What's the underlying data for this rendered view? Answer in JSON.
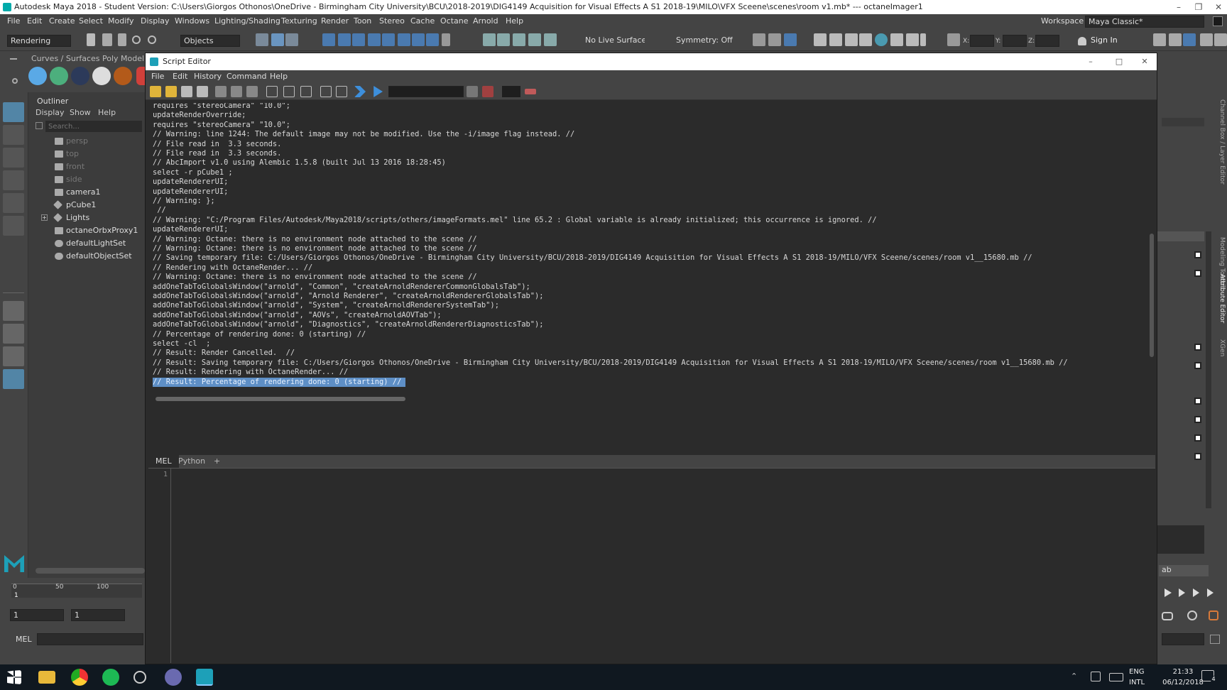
{
  "app": {
    "window_title": "Autodesk Maya 2018 - Student Version: C:\\Users\\Giorgos Othonos\\OneDrive - Birmingham City University\\BCU\\2018-2019\\DIG4149 Acquisition for Visual Effects A S1 2018-19\\MILO\\VFX Sceene\\scenes\\room v1.mb*   ---   octaneImager1",
    "menu": [
      "File",
      "Edit",
      "Create",
      "Select",
      "Modify",
      "Display",
      "Windows",
      "Lighting/Shading",
      "Texturing",
      "Render",
      "Toon",
      "Stereo",
      "Cache",
      "Octane",
      "Arnold",
      "Help"
    ],
    "workspace_label": "Workspace :",
    "workspace_value": "Maya Classic*",
    "menu_set": "Rendering",
    "selection_mode": "Objects",
    "live_surface": "No Live Surface",
    "symmetry": "Symmetry: Off",
    "sign_in": "Sign In",
    "xyz": [
      "X:",
      "Y:",
      "Z:"
    ]
  },
  "shelf": {
    "tabs": [
      "Curves / Surfaces",
      "Poly Modeling"
    ]
  },
  "outliner": {
    "title": "Outliner",
    "menu": [
      "Display",
      "Show",
      "Help"
    ],
    "search_placeholder": "Search...",
    "items": [
      {
        "label": "persp",
        "dim": true
      },
      {
        "label": "top",
        "dim": true
      },
      {
        "label": "front",
        "dim": true
      },
      {
        "label": "side",
        "dim": true
      },
      {
        "label": "camera1",
        "dim": false
      },
      {
        "label": "pCube1",
        "dim": false
      },
      {
        "label": "Lights",
        "dim": false,
        "expander": true
      },
      {
        "label": "octaneOrbxProxy1",
        "dim": false
      },
      {
        "label": "defaultLightSet",
        "dim": false
      },
      {
        "label": "defaultObjectSet",
        "dim": false
      }
    ]
  },
  "timeline": {
    "ticks": [
      "0",
      "50",
      "100"
    ],
    "current": "1",
    "start": "1",
    "end": "1"
  },
  "cmdline": {
    "label": "MEL"
  },
  "right_panel": {
    "side_tabs": [
      "Channel Box / Layer Editor",
      "Modeling Toolkit",
      "Attribute Editor",
      "XGen"
    ],
    "tab_partial": "ab"
  },
  "script_editor": {
    "title": "Script Editor",
    "menu": [
      "File",
      "Edit",
      "History",
      "Command",
      "Help"
    ],
    "history": [
      "requires \"stereoCamera\" \"10.0\";",
      "updateRenderOverride;",
      "requires \"stereoCamera\" \"10.0\";",
      "// Warning: line 1244: The default image may not be modified. Use the -i/image flag instead. //",
      "// File read in  3.3 seconds.",
      "// File read in  3.3 seconds.",
      "// AbcImport v1.0 using Alembic 1.5.8 (built Jul 13 2016 18:28:45)",
      "select -r pCube1 ;",
      "updateRendererUI;",
      "updateRendererUI;",
      "// Warning: };",
      " //",
      "// Warning: \"C:/Program Files/Autodesk/Maya2018/scripts/others/imageFormats.mel\" line 65.2 : Global variable is already initialized; this occurrence is ignored. //",
      "updateRendererUI;",
      "// Warning: Octane: there is no environment node attached to the scene //",
      "// Warning: Octane: there is no environment node attached to the scene //",
      "// Saving temporary file: C:/Users/Giorgos Othonos/OneDrive - Birmingham City University/BCU/2018-2019/DIG4149 Acquisition for Visual Effects A S1 2018-19/MILO/VFX Sceene/scenes/room v1__15680.mb //",
      "// Rendering with OctaneRender... //",
      "// Warning: Octane: there is no environment node attached to the scene //",
      "addOneTabToGlobalsWindow(\"arnold\", \"Common\", \"createArnoldRendererCommonGlobalsTab\");",
      "addOneTabToGlobalsWindow(\"arnold\", \"Arnold Renderer\", \"createArnoldRendererGlobalsTab\");",
      "addOneTabToGlobalsWindow(\"arnold\", \"System\", \"createArnoldRendererSystemTab\");",
      "addOneTabToGlobalsWindow(\"arnold\", \"AOVs\", \"createArnoldAOVTab\");",
      "addOneTabToGlobalsWindow(\"arnold\", \"Diagnostics\", \"createArnoldRendererDiagnosticsTab\");",
      "// Percentage of rendering done: 0 (starting) //",
      "select -cl  ;",
      "// Result: Render Cancelled.  //",
      "// Result: Saving temporary file: C:/Users/Giorgos Othonos/OneDrive - Birmingham City University/BCU/2018-2019/DIG4149 Acquisition for Visual Effects A S1 2018-19/MILO/VFX Sceene/scenes/room v1__15680.mb //",
      "// Result: Rendering with OctaneRender... //",
      "// Result: Percentage of rendering done: 0 (starting) //"
    ],
    "tabs": [
      "MEL",
      "Python",
      "+"
    ],
    "line_number": "1"
  },
  "taskbar": {
    "lang_line1": "ENG",
    "lang_line2": "INTL",
    "time": "21:33",
    "date": "06/12/2018",
    "notif_count": "4"
  }
}
